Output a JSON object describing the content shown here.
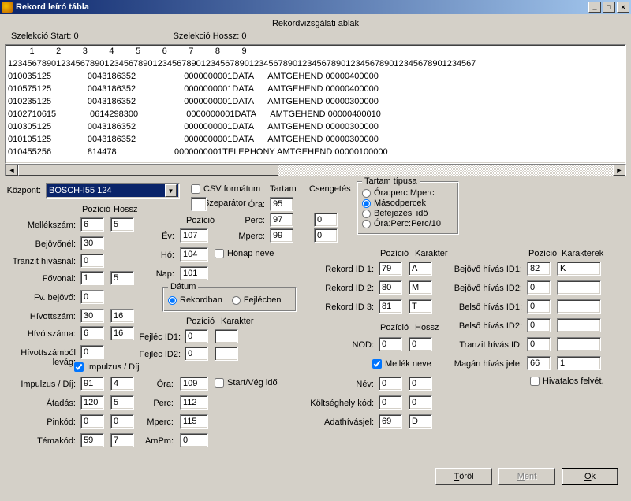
{
  "window": {
    "title": "Rekord leíró tábla"
  },
  "subheader": "Rekordvizsgálati ablak",
  "selection": {
    "start_label": "Szelekció Start:  0",
    "length_label": "Szelekció Hossz:  0"
  },
  "ruler1": "         1         2         3         4         5         6         7         8         9",
  "ruler2": "1234567890123456789012345678901234567890123456789012345678901234567890123456789012345678901234567",
  "rows": [
    "010035125               0043186352                    0000000001DATA      AMTGEHEND 00000400000",
    "010575125               0043186352                    0000000001DATA      AMTGEHEND 00000400000",
    "010235125               0043186352                    0000000001DATA      AMTGEHEND 00000300000",
    "0102710615              0614298300                    0000000001DATA      AMTGEHEND 00000400010",
    "010305125               0043186352                    0000000001DATA      AMTGEHEND 00000300000",
    "010105125               0043186352                    0000000001DATA      AMTGEHEND 00000300000",
    "010455256               814478                        0000000001TELEPHONY AMTGEHEND 00000100000"
  ],
  "kozpont": {
    "label": "Központ:",
    "value": "BOSCH-I55 124"
  },
  "csv": {
    "label": "CSV formátum",
    "sep_label": "Szeparátor",
    "sep": ""
  },
  "headers": {
    "tartam": "Tartam",
    "csengetes": "Csengetés",
    "pozicio": "Pozíció",
    "hossz": "Hossz",
    "karakter": "Karakter",
    "karakterek": "Karakterek"
  },
  "tartam_tipus": {
    "legend": "Tartam típusa",
    "o1": "Óra:perc:Mperc",
    "o2": "Másodpercek",
    "o3": "Befejezési idő",
    "o4": "Óra:Perc:Perc/10"
  },
  "fields": {
    "mellekszam": {
      "l": "Mellékszám:",
      "p": "6",
      "h": "5"
    },
    "bejovonel": {
      "l": "Bejövőnél:",
      "p": "30"
    },
    "tranzit": {
      "l": "Tranzit hívásnál:",
      "p": "0"
    },
    "fovonal": {
      "l": "Fővonal:",
      "p": "1",
      "h": "5"
    },
    "fvbejovo": {
      "l": "Fv. bejövő:",
      "p": "0"
    },
    "hivottszam": {
      "l": "Hívottszám:",
      "p": "30",
      "h": "16"
    },
    "hivoszama": {
      "l": "Hívó száma:",
      "p": "6",
      "h": "16"
    },
    "hlevag": {
      "l": "Hívottszámból levág:",
      "p": "0"
    },
    "impdij_chk": "Impulzus / Díj",
    "impdij": {
      "l": "Impulzus / Díj:",
      "p": "91",
      "h": "4"
    },
    "atadas": {
      "l": "Átadás:",
      "p": "120",
      "h": "5"
    },
    "pinkod": {
      "l": "Pinkód:",
      "p": "0",
      "h": "0"
    },
    "temakod": {
      "l": "Témakód:",
      "p": "59",
      "h": "7"
    },
    "ev": {
      "l": "Év:",
      "p": "107"
    },
    "ho": {
      "l": "Hó:",
      "p": "104"
    },
    "nap": {
      "l": "Nap:",
      "p": "101"
    },
    "honapneve": "Hónap neve",
    "datum": {
      "legend": "Dátum",
      "o1": "Rekordban",
      "o2": "Fejlécben"
    },
    "fejlec1": {
      "l": "Fejléc ID1:",
      "p": "0",
      "k": ""
    },
    "fejlec2": {
      "l": "Fejléc ID2:",
      "p": "0",
      "k": ""
    },
    "ora2": {
      "l": "Óra:",
      "p": "109"
    },
    "perc2": {
      "l": "Perc:",
      "p": "112"
    },
    "mperc2": {
      "l": "Mperc:",
      "p": "115"
    },
    "ampm": {
      "l": "AmPm:",
      "p": "0"
    },
    "startveg": "Start/Vég idő",
    "tora": {
      "l": "Óra:",
      "p": "95"
    },
    "tperc": {
      "l": "Perc:",
      "p": "97",
      "c": "0"
    },
    "tmperc": {
      "l": "Mperc:",
      "p": "99",
      "c": "0"
    },
    "rekid1": {
      "l": "Rekord ID 1:",
      "p": "79",
      "k": "A"
    },
    "rekid2": {
      "l": "Rekord ID 2:",
      "p": "80",
      "k": "M"
    },
    "rekid3": {
      "l": "Rekord ID 3:",
      "p": "81",
      "k": "T"
    },
    "nod": {
      "l": "NOD:",
      "p": "0",
      "h": "0"
    },
    "mellekneve": "Mellék neve",
    "nev": {
      "l": "Név:",
      "p": "0",
      "h": "0"
    },
    "koltseg": {
      "l": "Költséghely kód:",
      "p": "0",
      "h": "0"
    },
    "adathiv": {
      "l": "Adathívásjel:",
      "p": "69",
      "h": "D"
    },
    "bejid1": {
      "l": "Bejövő hívás ID1:",
      "p": "82",
      "k": "K"
    },
    "bejid2": {
      "l": "Bejövő hívás ID2:",
      "p": "0",
      "k": ""
    },
    "belid1": {
      "l": "Belső hívás ID1:",
      "p": "0",
      "k": ""
    },
    "belid2": {
      "l": "Belső hívás ID2:",
      "p": "0",
      "k": ""
    },
    "tranzitid": {
      "l": "Tranzit hívás ID:",
      "p": "0",
      "k": ""
    },
    "magan": {
      "l": "Magán hívás jele:",
      "p": "66",
      "k": "1"
    },
    "hivatalos": "Hivatalos felvét."
  },
  "buttons": {
    "torol": "Töröl",
    "ment": "Ment",
    "ok": "Ok"
  }
}
